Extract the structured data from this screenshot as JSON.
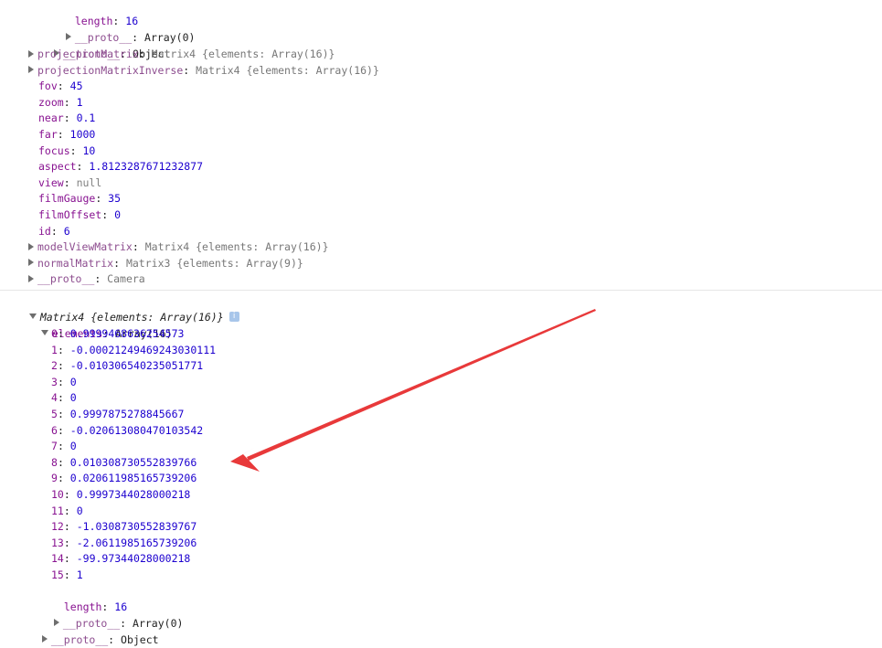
{
  "top": {
    "length_key": "length",
    "length_val": "16",
    "proto_array_key": "__proto__",
    "proto_array_val": "Array(0)",
    "proto_object_key": "__proto__",
    "proto_object_val": "Object",
    "camera_props": [
      {
        "key": "projectionMatrix",
        "val": "Matrix4 {elements: Array(16)}",
        "expandable": true,
        "dim": true
      },
      {
        "key": "projectionMatrixInverse",
        "val": "Matrix4 {elements: Array(16)}",
        "expandable": true,
        "dim": true
      },
      {
        "key": "fov",
        "val": "45"
      },
      {
        "key": "zoom",
        "val": "1"
      },
      {
        "key": "near",
        "val": "0.1"
      },
      {
        "key": "far",
        "val": "1000"
      },
      {
        "key": "focus",
        "val": "10"
      },
      {
        "key": "aspect",
        "val": "1.8123287671232877"
      },
      {
        "key": "view",
        "val": "null",
        "isNull": true
      },
      {
        "key": "filmGauge",
        "val": "35"
      },
      {
        "key": "filmOffset",
        "val": "0"
      },
      {
        "key": "id",
        "val": "6"
      },
      {
        "key": "modelViewMatrix",
        "val": "Matrix4 {elements: Array(16)}",
        "expandable": true,
        "dim": true
      },
      {
        "key": "normalMatrix",
        "val": "Matrix3 {elements: Array(9)}",
        "expandable": true,
        "dim": true
      },
      {
        "key": "__proto__",
        "val": "Camera",
        "expandable": true,
        "dim": true
      }
    ]
  },
  "matrix": {
    "header": "Matrix4 {elements: Array(16)}",
    "info": "i",
    "elements_key": "elements",
    "elements_val": "Array(16)",
    "items": [
      {
        "idx": "0",
        "val": "0.9999468636254573"
      },
      {
        "idx": "1",
        "val": "-0.00021249469243030111"
      },
      {
        "idx": "2",
        "val": "-0.010306540235051771"
      },
      {
        "idx": "3",
        "val": "0"
      },
      {
        "idx": "4",
        "val": "0"
      },
      {
        "idx": "5",
        "val": "0.9997875278845667"
      },
      {
        "idx": "6",
        "val": "-0.020613080470103542"
      },
      {
        "idx": "7",
        "val": "0"
      },
      {
        "idx": "8",
        "val": "0.010308730552839766"
      },
      {
        "idx": "9",
        "val": "0.020611985165739206"
      },
      {
        "idx": "10",
        "val": "0.9997344028000218"
      },
      {
        "idx": "11",
        "val": "0"
      },
      {
        "idx": "12",
        "val": "-1.0308730552839767"
      },
      {
        "idx": "13",
        "val": "-2.0611985165739206"
      },
      {
        "idx": "14",
        "val": "-99.97344028000218"
      },
      {
        "idx": "15",
        "val": "1"
      }
    ],
    "length_key": "length",
    "length_val": "16",
    "proto_array_key": "__proto__",
    "proto_array_val": "Array(0)",
    "proto_object_key": "__proto__",
    "proto_object_val": "Object"
  },
  "colors": {
    "arrow": "#e8393a"
  }
}
